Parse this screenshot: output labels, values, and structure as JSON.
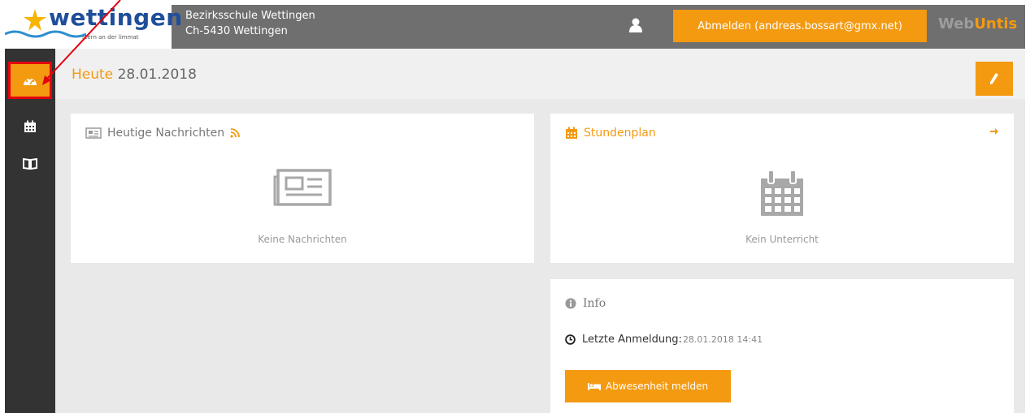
{
  "header": {
    "logo_text": "wettingen",
    "logo_tagline": "stern an der limmat",
    "school_name": "Bezirksschule Wettingen",
    "school_address": "Ch-5430 Wettingen",
    "logout_label": "Abmelden (andreas.bossart@gmx.net)",
    "brand_web": "Web",
    "brand_untis": "Untis"
  },
  "sidebar": {
    "items": [
      {
        "icon": "dashboard-icon",
        "active": true
      },
      {
        "icon": "calendar-icon",
        "active": false
      },
      {
        "icon": "book-icon",
        "active": false
      }
    ]
  },
  "title": {
    "label": "Heute",
    "date": "28.01.2018"
  },
  "news": {
    "title": "Heutige Nachrichten",
    "empty_text": "Keine Nachrichten"
  },
  "timetable": {
    "title": "Stundenplan",
    "empty_text": "Kein Unterricht"
  },
  "info": {
    "title": "Info",
    "last_login_label": "Letzte Anmeldung:",
    "last_login_value": "28.01.2018 14:41",
    "absence_button": "Abwesenheit melden"
  },
  "colors": {
    "accent": "#f49a11",
    "sidebar": "#333333",
    "header": "#6f6f6f",
    "highlight": "#e3000f"
  }
}
